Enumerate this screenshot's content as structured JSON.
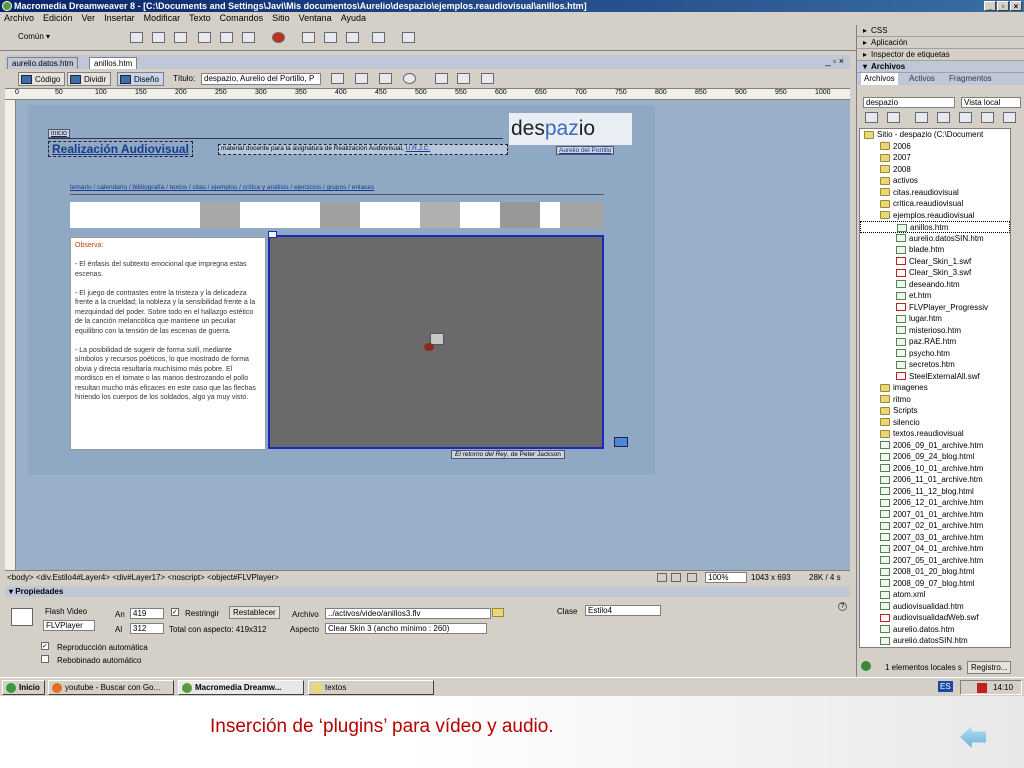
{
  "window": {
    "title": "Macromedia Dreamweaver 8 - [C:\\Documents and Settings\\Javi\\Mis documentos\\Aurelio\\despazio\\ejemplos.reaudiovisual\\anillos.htm]",
    "btn_min": "_",
    "btn_max": "▫",
    "btn_close": "×"
  },
  "menu": [
    "Archivo",
    "Edición",
    "Ver",
    "Insertar",
    "Modificar",
    "Texto",
    "Comandos",
    "Sitio",
    "Ventana",
    "Ayuda"
  ],
  "insert_bar": {
    "category": "Común"
  },
  "doc_tabs": [
    "aurelio.datos.htm",
    "anillos.htm"
  ],
  "doc_toolbar": {
    "code": "Código",
    "split": "Dividir",
    "design": "Diseño",
    "title_label": "Título:",
    "title_value": "despazio, Aurelio del Portillo, P"
  },
  "ruler_ticks": [
    "0",
    "50",
    "100",
    "150",
    "200",
    "250",
    "300",
    "350",
    "400",
    "450",
    "500",
    "550",
    "600",
    "650",
    "700",
    "750",
    "800",
    "850",
    "900",
    "950",
    "1000"
  ],
  "page": {
    "inicio": "inicio",
    "heading": "Realización Audiovisual",
    "logo_a": "des",
    "logo_b": "paz",
    "logo_c": "io",
    "subtitle_a": "material docente para la asignatura de Realización Audiovisual,",
    "subtitle_b": "U.R.J.C.",
    "author_link": "Aurelio del Portillo",
    "nav": "temario / calendario / bibliografía / textos / citas / ejemplos / crítica y análisis / ejercicios / grupos / enlaces",
    "obs_title": "Observa:",
    "obs_p1": "- El énfasis del subtexto emocional que impregna estas escenas.",
    "obs_p2": "- El juego de contrastes entre la tristeza y la delicadeza frente a la crueldad; la nobleza y la sensibilidad frente a la mezquindad del poder. Sobre todo en el hallazgo estético de la canción melancólica que mantiene un peculiar equilibrio con la tensión de las escenas de guerra.",
    "obs_p3": "- La posibilidad de sugerir de forma sutil, mediante símbolos y recursos poéticos, lo que mostrado de forma obvia y directa resultaría muchísimo más pobre. El mordisco en el tomate o las manos destrozando el pollo resultan mucho más eficaces en este caso que las flechas hiriendo los cuerpos de los soldados, algo ya muy visto.",
    "video_caption_a": "El retorno del Rey",
    "video_caption_b": ", de Peter Jackson"
  },
  "statusbar": {
    "tags": "<body> <div.Estilo4#Layer4> <div#Layer17> <noscript> <object#FLVPlayer>",
    "zoom": "100%",
    "size": "1043 x 693",
    "weight": "28K / 4 s"
  },
  "props": {
    "title": "Propiedades",
    "type": "Flash Video",
    "name": "FLVPlayer",
    "an_label": "An",
    "an": "419",
    "al_label": "Al",
    "al": "312",
    "restrict": "Restringir",
    "reset": "Restablecer",
    "total": "Total con aspecto: 419x312",
    "file_label": "Archivo",
    "file": "../activos/video/anillos3.flv",
    "aspect_label": "Aspecto",
    "aspect": "Clear Skin 3 (ancho mínimo : 260)",
    "class_label": "Clase",
    "class": "Estilo4",
    "autoplay": "Reproducción automática",
    "autorewind": "Rebobinado automático"
  },
  "panels": {
    "css": "CSS",
    "app": "Aplicación",
    "tag": "Inspector de etiquetas",
    "files": "Archivos"
  },
  "files_tabs": [
    "Archivos",
    "Activos",
    "Fragmentos"
  ],
  "site": "despazio",
  "view": "Vista local",
  "tree": [
    {
      "t": "Sitio - despazio (C:\\Document",
      "k": "fold",
      "d": 0
    },
    {
      "t": "2006",
      "k": "fold",
      "d": 1
    },
    {
      "t": "2007",
      "k": "fold",
      "d": 1
    },
    {
      "t": "2008",
      "k": "fold",
      "d": 1
    },
    {
      "t": "activos",
      "k": "fold",
      "d": 1
    },
    {
      "t": "citas.reaudiovisual",
      "k": "fold",
      "d": 1
    },
    {
      "t": "critica.reaudiovisual",
      "k": "fold",
      "d": 1
    },
    {
      "t": "ejemplos.reaudiovisual",
      "k": "fold",
      "d": 1
    },
    {
      "t": "anillos.htm",
      "k": "file",
      "d": 2
    },
    {
      "t": "aurelio.datosSIN.htm",
      "k": "file",
      "d": 2
    },
    {
      "t": "blade.htm",
      "k": "file",
      "d": 2
    },
    {
      "t": "Clear_Skin_1.swf",
      "k": "swf",
      "d": 2
    },
    {
      "t": "Clear_Skin_3.swf",
      "k": "swf",
      "d": 2
    },
    {
      "t": "deseando.htm",
      "k": "file",
      "d": 2
    },
    {
      "t": "et.htm",
      "k": "file",
      "d": 2
    },
    {
      "t": "FLVPlayer_Progressiv",
      "k": "swf",
      "d": 2
    },
    {
      "t": "lugar.htm",
      "k": "file",
      "d": 2
    },
    {
      "t": "misterioso.htm",
      "k": "file",
      "d": 2
    },
    {
      "t": "paz.RAE.htm",
      "k": "file",
      "d": 2
    },
    {
      "t": "psycho.htm",
      "k": "file",
      "d": 2
    },
    {
      "t": "secretos.htm",
      "k": "file",
      "d": 2
    },
    {
      "t": "SteelExternalAll.swf",
      "k": "swf",
      "d": 2
    },
    {
      "t": "imagenes",
      "k": "fold",
      "d": 1
    },
    {
      "t": "ritmo",
      "k": "fold",
      "d": 1
    },
    {
      "t": "Scripts",
      "k": "fold",
      "d": 1
    },
    {
      "t": "silencio",
      "k": "fold",
      "d": 1
    },
    {
      "t": "textos.reaudiovisual",
      "k": "fold",
      "d": 1
    },
    {
      "t": "2006_09_01_archive.htm",
      "k": "file",
      "d": 1
    },
    {
      "t": "2006_09_24_blog.html",
      "k": "file",
      "d": 1
    },
    {
      "t": "2006_10_01_archive.htm",
      "k": "file",
      "d": 1
    },
    {
      "t": "2006_11_01_archive.htm",
      "k": "file",
      "d": 1
    },
    {
      "t": "2006_11_12_blog.html",
      "k": "file",
      "d": 1
    },
    {
      "t": "2006_12_01_archive.htm",
      "k": "file",
      "d": 1
    },
    {
      "t": "2007_01_01_archive.htm",
      "k": "file",
      "d": 1
    },
    {
      "t": "2007_02_01_archive.htm",
      "k": "file",
      "d": 1
    },
    {
      "t": "2007_03_01_archive.htm",
      "k": "file",
      "d": 1
    },
    {
      "t": "2007_04_01_archive.htm",
      "k": "file",
      "d": 1
    },
    {
      "t": "2007_05_01_archive.htm",
      "k": "file",
      "d": 1
    },
    {
      "t": "2008_01_20_blog.html",
      "k": "file",
      "d": 1
    },
    {
      "t": "2008_09_07_blog.html",
      "k": "file",
      "d": 1
    },
    {
      "t": "atom.xml",
      "k": "file",
      "d": 1
    },
    {
      "t": "audiovisualidad.htm",
      "k": "file",
      "d": 1
    },
    {
      "t": "audiovisualidadWeb.swf",
      "k": "swf",
      "d": 1
    },
    {
      "t": "aurelio.datos.htm",
      "k": "file",
      "d": 1
    },
    {
      "t": "aurelio.datosSIN.htm",
      "k": "file",
      "d": 1
    }
  ],
  "files_status": "1 elementos locales s",
  "registro": "Registro...",
  "taskbar": {
    "start": "Inicio",
    "t1": "youtube - Buscar con Go...",
    "t2": "Macromedia Dreamw...",
    "t3": "textos",
    "lang": "ES",
    "time": "14:10"
  },
  "caption": "Inserción de ‘plugins’ para vídeo y audio."
}
